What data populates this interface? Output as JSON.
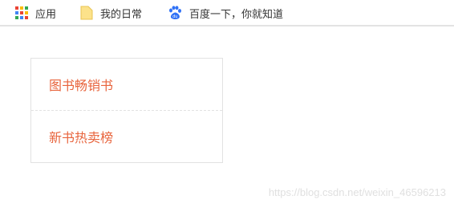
{
  "bookmarks": {
    "apps_label": "应用",
    "daily_label": "我的日常",
    "baidu_label": "百度一下，你就知道",
    "apps_icon": "apps-grid-icon",
    "daily_icon": "folder-icon",
    "baidu_icon": "baidu-paw-icon",
    "apps_grid_colors": [
      "#ea4335",
      "#fbbc05",
      "#34a853",
      "#4285f4",
      "#ea4335",
      "#fbbc05",
      "#34a853",
      "#4285f4",
      "#ea4335"
    ]
  },
  "menu": {
    "items": [
      {
        "label": "图书畅销书"
      },
      {
        "label": "新书热卖榜"
      }
    ],
    "text_color": "#e8653e",
    "border_color": "#e2e2e2"
  },
  "watermark": {
    "text": "https://blog.csdn.net/weixin_46596213"
  }
}
